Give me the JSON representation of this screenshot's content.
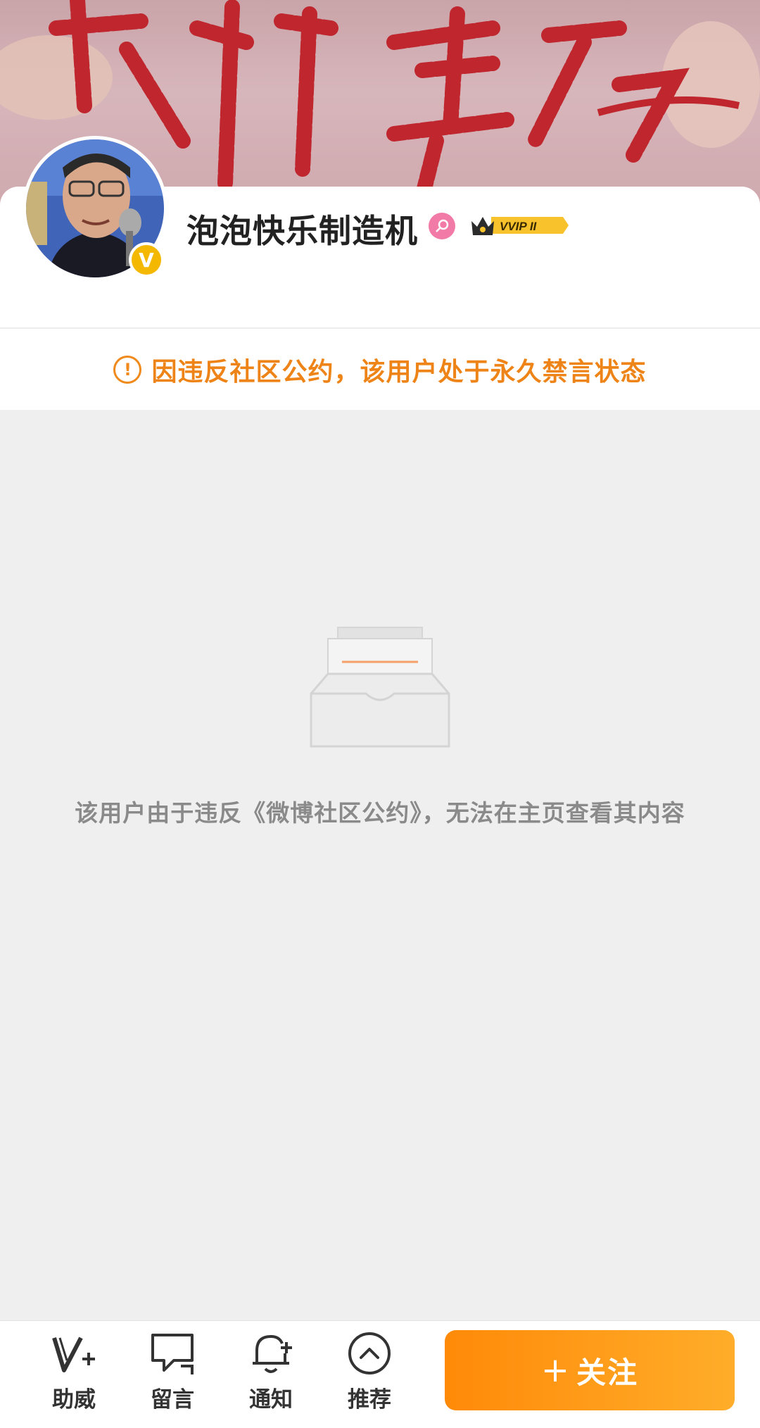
{
  "profile": {
    "username": "泡泡快乐制造机",
    "gender": "female",
    "vip_badge": "VVIP II",
    "verified": true,
    "verify_badge_label": "V"
  },
  "notice": {
    "icon": "exclamation-circle-icon",
    "text": "因违反社区公约，该用户处于永久禁言状态",
    "color": "#ee8417"
  },
  "empty_state": {
    "icon": "empty-inbox-icon",
    "message": "该用户由于违反《微博社区公约》，无法在主页查看其内容"
  },
  "bottom_bar": {
    "tabs": [
      {
        "label": "助威",
        "icon": "cheer-v-plus-icon"
      },
      {
        "label": "留言",
        "icon": "message-bubble-icon"
      },
      {
        "label": "通知",
        "icon": "bell-plus-icon"
      },
      {
        "label": "推荐",
        "icon": "chevron-up-circle-icon"
      }
    ],
    "follow_button": {
      "plus": "+",
      "label": "关注"
    },
    "accent_color": "#ff8a08"
  }
}
